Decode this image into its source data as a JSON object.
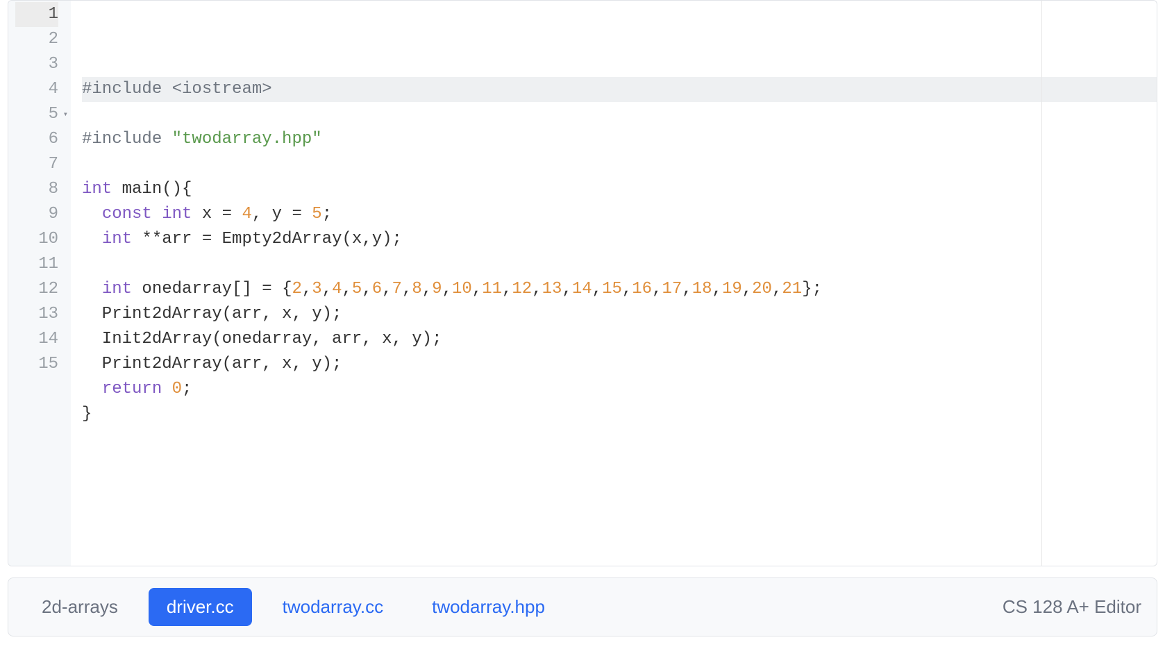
{
  "gutter": {
    "lines": [
      "1",
      "2",
      "3",
      "4",
      "5",
      "6",
      "7",
      "8",
      "9",
      "10",
      "11",
      "12",
      "13",
      "14",
      "15"
    ],
    "active_line_index": 0,
    "fold_line_index": 4
  },
  "code": {
    "lines": [
      [
        {
          "cls": "tok-preproc",
          "t": "#include "
        },
        {
          "cls": "tok-preproc",
          "t": "<iostream>"
        }
      ],
      [
        {
          "cls": "tok-plain",
          "t": ""
        }
      ],
      [
        {
          "cls": "tok-preproc",
          "t": "#include "
        },
        {
          "cls": "tok-string",
          "t": "\"twodarray.hpp\""
        }
      ],
      [
        {
          "cls": "tok-plain",
          "t": ""
        }
      ],
      [
        {
          "cls": "tok-type",
          "t": "int"
        },
        {
          "cls": "tok-plain",
          "t": " main(){"
        }
      ],
      [
        {
          "cls": "tok-plain",
          "t": "  "
        },
        {
          "cls": "tok-keyword",
          "t": "const"
        },
        {
          "cls": "tok-plain",
          "t": " "
        },
        {
          "cls": "tok-type",
          "t": "int"
        },
        {
          "cls": "tok-plain",
          "t": " x = "
        },
        {
          "cls": "tok-number",
          "t": "4"
        },
        {
          "cls": "tok-plain",
          "t": ", y = "
        },
        {
          "cls": "tok-number",
          "t": "5"
        },
        {
          "cls": "tok-plain",
          "t": ";"
        }
      ],
      [
        {
          "cls": "tok-plain",
          "t": "  "
        },
        {
          "cls": "tok-type",
          "t": "int"
        },
        {
          "cls": "tok-plain",
          "t": " **arr = Empty2dArray(x,y);"
        }
      ],
      [
        {
          "cls": "tok-plain",
          "t": ""
        }
      ],
      [
        {
          "cls": "tok-plain",
          "t": "  "
        },
        {
          "cls": "tok-type",
          "t": "int"
        },
        {
          "cls": "tok-plain",
          "t": " onedarray[] = {"
        },
        {
          "cls": "tok-number",
          "t": "2"
        },
        {
          "cls": "tok-plain",
          "t": ","
        },
        {
          "cls": "tok-number",
          "t": "3"
        },
        {
          "cls": "tok-plain",
          "t": ","
        },
        {
          "cls": "tok-number",
          "t": "4"
        },
        {
          "cls": "tok-plain",
          "t": ","
        },
        {
          "cls": "tok-number",
          "t": "5"
        },
        {
          "cls": "tok-plain",
          "t": ","
        },
        {
          "cls": "tok-number",
          "t": "6"
        },
        {
          "cls": "tok-plain",
          "t": ","
        },
        {
          "cls": "tok-number",
          "t": "7"
        },
        {
          "cls": "tok-plain",
          "t": ","
        },
        {
          "cls": "tok-number",
          "t": "8"
        },
        {
          "cls": "tok-plain",
          "t": ","
        },
        {
          "cls": "tok-number",
          "t": "9"
        },
        {
          "cls": "tok-plain",
          "t": ","
        },
        {
          "cls": "tok-number",
          "t": "10"
        },
        {
          "cls": "tok-plain",
          "t": ","
        },
        {
          "cls": "tok-number",
          "t": "11"
        },
        {
          "cls": "tok-plain",
          "t": ","
        },
        {
          "cls": "tok-number",
          "t": "12"
        },
        {
          "cls": "tok-plain",
          "t": ","
        },
        {
          "cls": "tok-number",
          "t": "13"
        },
        {
          "cls": "tok-plain",
          "t": ","
        },
        {
          "cls": "tok-number",
          "t": "14"
        },
        {
          "cls": "tok-plain",
          "t": ","
        },
        {
          "cls": "tok-number",
          "t": "15"
        },
        {
          "cls": "tok-plain",
          "t": ","
        },
        {
          "cls": "tok-number",
          "t": "16"
        },
        {
          "cls": "tok-plain",
          "t": ","
        },
        {
          "cls": "tok-number",
          "t": "17"
        },
        {
          "cls": "tok-plain",
          "t": ","
        },
        {
          "cls": "tok-number",
          "t": "18"
        },
        {
          "cls": "tok-plain",
          "t": ","
        },
        {
          "cls": "tok-number",
          "t": "19"
        },
        {
          "cls": "tok-plain",
          "t": ","
        },
        {
          "cls": "tok-number",
          "t": "20"
        },
        {
          "cls": "tok-plain",
          "t": ","
        },
        {
          "cls": "tok-number",
          "t": "21"
        },
        {
          "cls": "tok-plain",
          "t": "};"
        }
      ],
      [
        {
          "cls": "tok-plain",
          "t": "  Print2dArray(arr, x, y);"
        }
      ],
      [
        {
          "cls": "tok-plain",
          "t": "  Init2dArray(onedarray, arr, x, y);"
        }
      ],
      [
        {
          "cls": "tok-plain",
          "t": "  Print2dArray(arr, x, y);"
        }
      ],
      [
        {
          "cls": "tok-plain",
          "t": "  "
        },
        {
          "cls": "tok-keyword",
          "t": "return"
        },
        {
          "cls": "tok-plain",
          "t": " "
        },
        {
          "cls": "tok-number",
          "t": "0"
        },
        {
          "cls": "tok-plain",
          "t": ";"
        }
      ],
      [
        {
          "cls": "tok-plain",
          "t": "}"
        }
      ],
      [
        {
          "cls": "tok-plain",
          "t": ""
        }
      ]
    ]
  },
  "tabs": {
    "project": "2d-arrays",
    "items": [
      {
        "label": "driver.cc",
        "active": true
      },
      {
        "label": "twodarray.cc",
        "active": false
      },
      {
        "label": "twodarray.hpp",
        "active": false
      }
    ],
    "brand": "CS 128 A+ Editor"
  }
}
